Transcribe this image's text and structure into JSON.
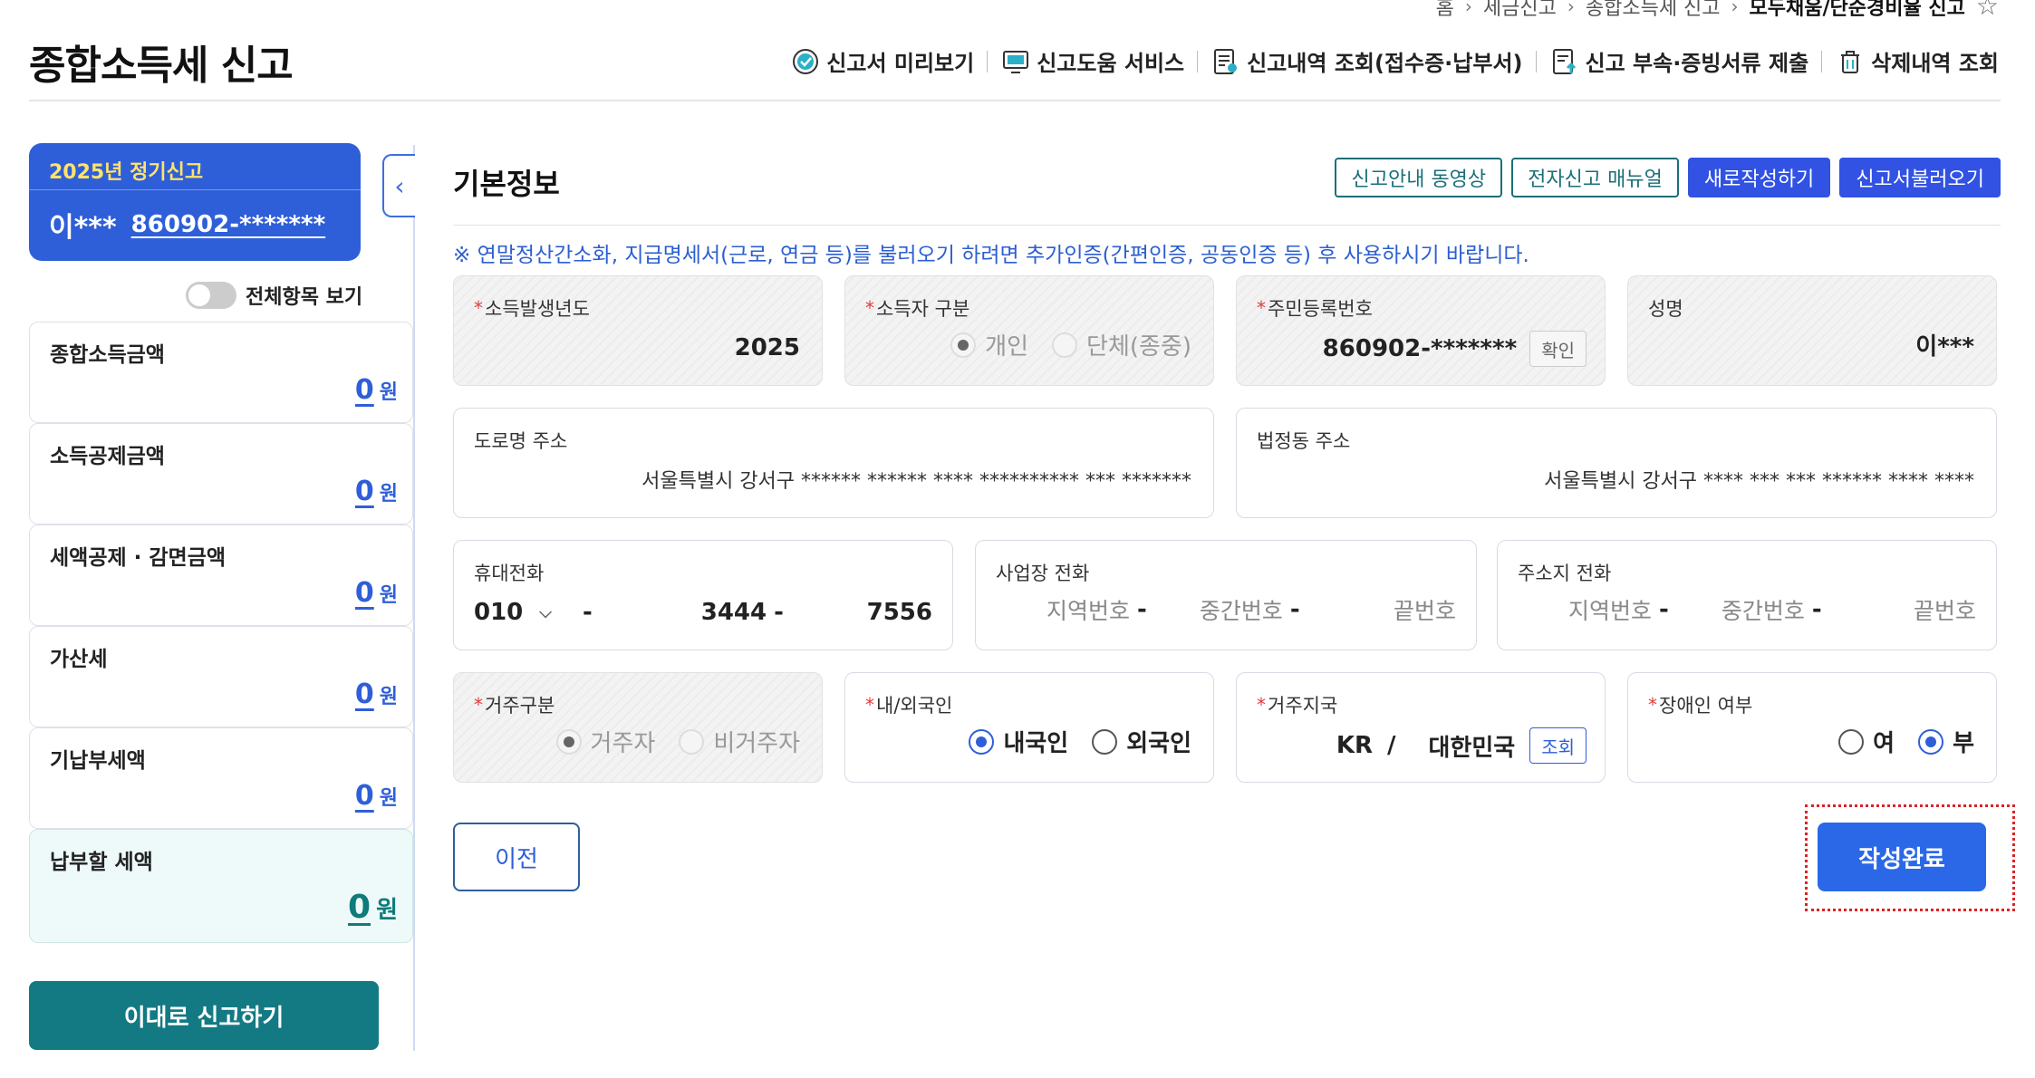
{
  "breadcrumb": {
    "items": [
      "홈",
      "세금신고",
      "종합소득세 신고",
      "모두채움/단순경비율 신고"
    ]
  },
  "page": {
    "title": "종합소득세 신고"
  },
  "header_links": [
    {
      "label": "신고서 미리보기",
      "icon": "check-circle-icon"
    },
    {
      "label": "신고도움 서비스",
      "icon": "monitor-help-icon"
    },
    {
      "label": "신고내역 조회(접수증·납부서)",
      "icon": "document-search-icon"
    },
    {
      "label": "신고 부속·증빙서류 제출",
      "icon": "document-upload-icon"
    },
    {
      "label": "삭제내역 조회",
      "icon": "trash-icon"
    }
  ],
  "sidebar": {
    "filing_title": "2025년 정기신고",
    "user_name": "이***",
    "user_id": "860902-*******",
    "toggle_label": "전체항목 보기",
    "items": [
      {
        "label": "종합소득금액",
        "value": "0",
        "unit": "원"
      },
      {
        "label": "소득공제금액",
        "value": "0",
        "unit": "원"
      },
      {
        "label": "세액공제 · 감면금액",
        "value": "0",
        "unit": "원"
      },
      {
        "label": "가산세",
        "value": "0",
        "unit": "원"
      },
      {
        "label": "기납부세액",
        "value": "0",
        "unit": "원"
      },
      {
        "label": "납부할 세액",
        "value": "0",
        "unit": "원"
      }
    ],
    "submit_label": "이대로 신고하기"
  },
  "main": {
    "section_title": "기본정보",
    "buttons": {
      "video": "신고안내 동영상",
      "manual": "전자신고 매뉴얼",
      "new": "새로작성하기",
      "load": "신고서불러오기"
    },
    "notice": "※ 연말정산간소화, 지급명세서(근로, 연금 등)를 불러오기 하려면 추가인증(간편인증, 공동인증 등) 후 사용하시기 바랍니다.",
    "income_year": {
      "label": "소득발생년도",
      "value": "2025"
    },
    "earner_type": {
      "label": "소득자 구분",
      "opt1": "개인",
      "opt2": "단체(종중)"
    },
    "rrn": {
      "label": "주민등록번호",
      "value": "860902-*******",
      "confirm": "확인"
    },
    "name": {
      "label": "성명",
      "value": "이***"
    },
    "road_addr": {
      "label": "도로명 주소",
      "value": "서울특별시 강서구 ****** ****** **** ********** *** *******"
    },
    "legal_addr": {
      "label": "법정동 주소",
      "value": "서울특별시 강서구 **** *** *** ****** **** ****"
    },
    "mobile": {
      "label": "휴대전화",
      "prefix": "010",
      "middle": "3444",
      "last": "7556"
    },
    "biz_phone": {
      "label": "사업장 전화",
      "ph1": "지역번호",
      "ph2": "중간번호",
      "ph3": "끝번호"
    },
    "home_phone": {
      "label": "주소지 전화",
      "ph1": "지역번호",
      "ph2": "중간번호",
      "ph3": "끝번호"
    },
    "residency": {
      "label": "거주구분",
      "opt1": "거주자",
      "opt2": "비거주자"
    },
    "nationality": {
      "label": "내/외국인",
      "opt1": "내국인",
      "opt2": "외국인"
    },
    "country": {
      "label": "거주지국",
      "code": "KR",
      "sep": "/",
      "name": "대한민국",
      "lookup": "조회"
    },
    "disability": {
      "label": "장애인 여부",
      "opt1": "여",
      "opt2": "부"
    },
    "prev_label": "이전",
    "done_label": "작성완료"
  }
}
